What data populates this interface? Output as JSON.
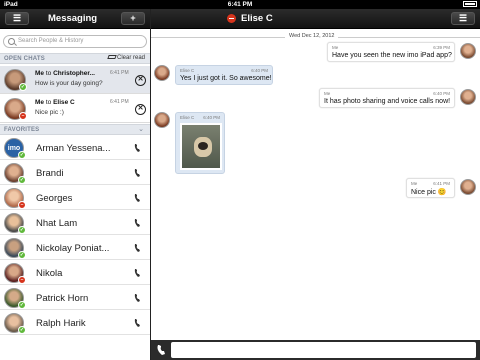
{
  "status_bar": {
    "device": "iPad",
    "time": "6:41 PM"
  },
  "sidebar_header": {
    "menu_icon": "menu-icon",
    "title": "Messaging",
    "add_label": "+"
  },
  "conversation_header": {
    "title": "Elise C",
    "status_color": "#d6341c",
    "menu_icon": "menu-icon"
  },
  "search": {
    "placeholder": "Search People & History"
  },
  "open_chats": {
    "label": "OPEN CHATS",
    "clear_label": "Clear read",
    "items": [
      {
        "from": "Me",
        "to_word": "to",
        "name": "Christopher...",
        "time": "6:41 PM",
        "message": "How is your day going?",
        "status": "online"
      },
      {
        "from": "Me",
        "to_word": "to",
        "name": "Elise C",
        "time": "6:41 PM",
        "message": "Nice pic :)",
        "status": "busy"
      }
    ]
  },
  "favorites": {
    "label": "FAVORITES",
    "items": [
      {
        "name": "Arman Yessena...",
        "status": "online"
      },
      {
        "name": "Brandi",
        "status": "online"
      },
      {
        "name": "Georges",
        "status": "busy"
      },
      {
        "name": "Nhat Lam",
        "status": "online"
      },
      {
        "name": "Nickolay Poniat...",
        "status": "online"
      },
      {
        "name": "Nikola",
        "status": "busy"
      },
      {
        "name": "Patrick Horn",
        "status": "online"
      },
      {
        "name": "Ralph Harik",
        "status": "online"
      }
    ]
  },
  "conversation": {
    "date": "Wed Dec 12, 2012",
    "messages": [
      {
        "sender": "Me",
        "time": "6:39 PM",
        "text": "Have you seen the new imo iPad app?",
        "side": "right"
      },
      {
        "sender": "Elise C",
        "time": "6:40 PM",
        "text": "Yes I just got it. So awesome!",
        "side": "left"
      },
      {
        "sender": "Me",
        "time": "6:40 PM",
        "text": "It has photo sharing and voice calls now!",
        "side": "right"
      },
      {
        "sender": "Elise C",
        "time": "6:40 PM",
        "text": "",
        "side": "left",
        "photo": true
      },
      {
        "sender": "Me",
        "time": "6:41 PM",
        "text": "Nice pic 😊",
        "side": "right"
      }
    ]
  },
  "colors": {
    "online": "#5fb83a",
    "busy": "#d6341c",
    "header": "#1c1c1c",
    "them_bubble": "#dde7f3"
  }
}
